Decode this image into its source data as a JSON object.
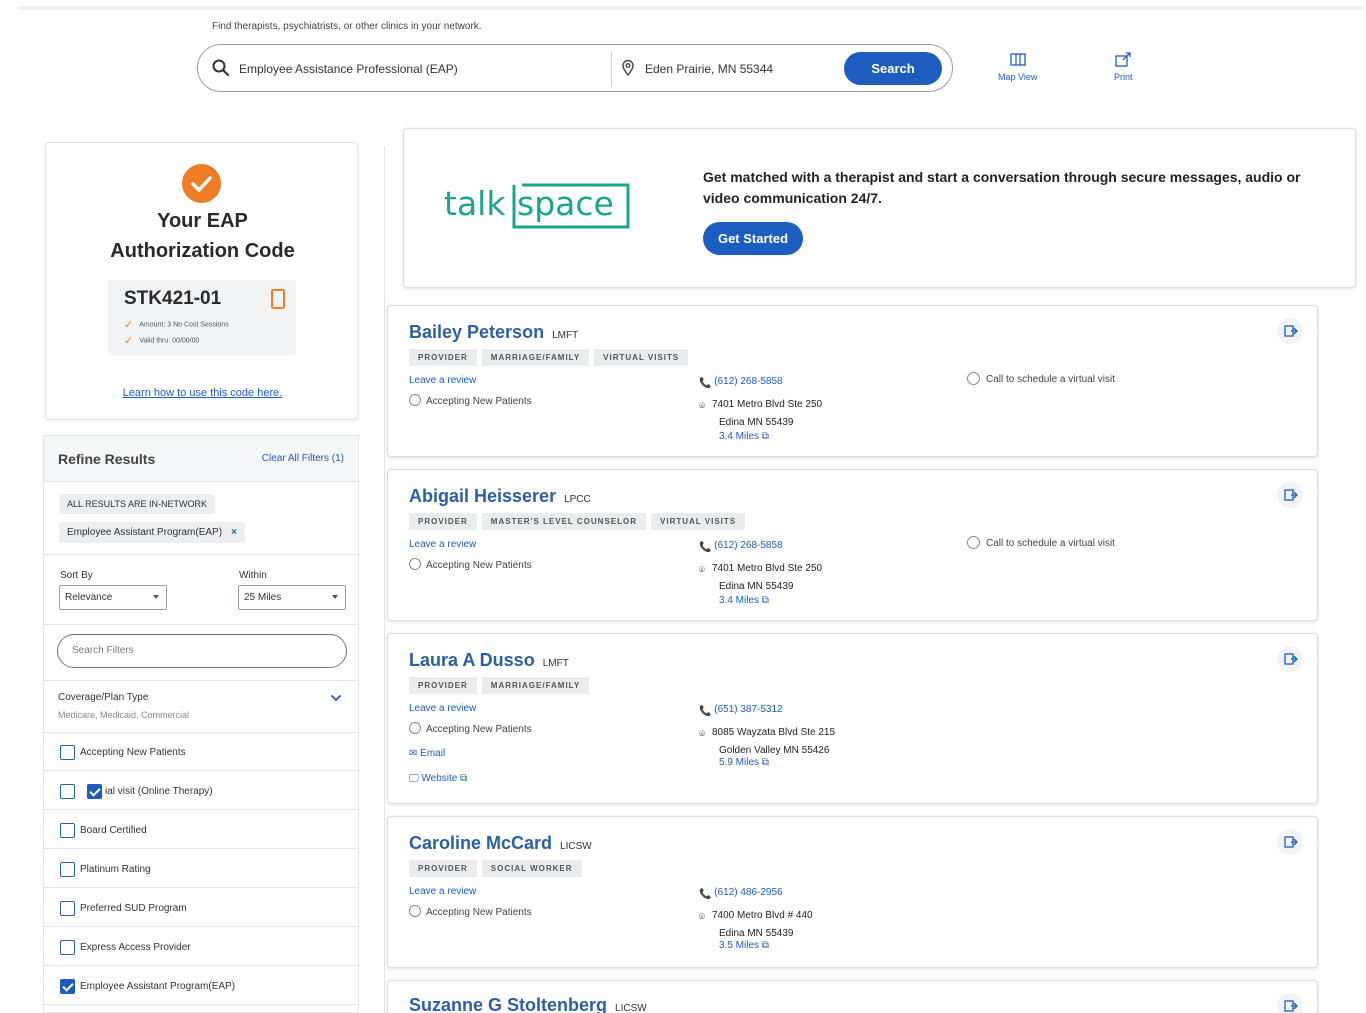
{
  "header": {
    "hint": "Find therapists, psychiatrists, or other clinics in your network.",
    "query": "Employee Assistance Professional (EAP)",
    "location": "Eden Prairie, MN 55344",
    "search_label": "Search",
    "map_label": "Map View",
    "print_label": "Print"
  },
  "eap": {
    "title_line1": "Your EAP",
    "title_line2": "Authorization Code",
    "code": "STK421-01",
    "detail1": "Amount: 3 No Cost Sessions",
    "detail2": "Valid thru: 00/00/00",
    "learn_link": "Learn how to use this code here."
  },
  "refine": {
    "title": "Refine Results",
    "clear_label": "Clear All Filters (1)",
    "network_pill": "ALL RESULTS ARE IN-NETWORK",
    "active_filter": "Employee Assistant Program(EAP)",
    "remove_filter": "×",
    "sort_label": "Sort By",
    "sort_value": "Relevance",
    "within_label": "Within",
    "within_value": "25 Miles",
    "filter_placeholder": "Search Filters",
    "coverage_title": "Coverage/Plan Type",
    "coverage_sub": "Medicare, Medicaid, Commercial",
    "checkboxes": [
      {
        "label": "Accepting New Patients",
        "checked": false
      },
      {
        "label": "ial visit (Online Therapy)",
        "checked": false
      },
      {
        "label": "Board Certified",
        "checked": false
      },
      {
        "label": "Platinum Rating",
        "checked": false
      },
      {
        "label": "Preferred SUD Program",
        "checked": false
      },
      {
        "label": "Express Access Provider",
        "checked": false
      },
      {
        "label": "Employee Assistant Program(EAP)",
        "checked": true
      }
    ]
  },
  "banner": {
    "logo_left": "talk",
    "logo_right": "space",
    "text": "Get matched with a therapist and start a conversation through secure messages, audio or video communication 24/7.",
    "button": "Get Started"
  },
  "common": {
    "review": "Leave a review",
    "accepting": "Accepting New Patients",
    "virtual": "Call to schedule a virtual visit",
    "email": "Email",
    "website": "Website"
  },
  "providers": [
    {
      "name": "Bailey Peterson",
      "cred": "LMFT",
      "tags": [
        "PROVIDER",
        "MARRIAGE/FAMILY",
        "VIRTUAL VISITS"
      ],
      "phone": "(612) 268-5858",
      "addr1": "7401 Metro Blvd Ste 250",
      "addr2": "Edina MN 55439",
      "miles": "3.4 Miles",
      "virtual": true
    },
    {
      "name": "Abigail Heisserer",
      "cred": "LPCC",
      "tags": [
        "PROVIDER",
        "MASTER'S LEVEL COUNSELOR",
        "VIRTUAL VISITS"
      ],
      "phone": "(612) 268-5858",
      "addr1": "7401 Metro Blvd Ste 250",
      "addr2": "Edina MN 55439",
      "miles": "3.4 Miles",
      "virtual": true
    },
    {
      "name": "Laura A Dusso",
      "cred": "LMFT",
      "tags": [
        "PROVIDER",
        "MARRIAGE/FAMILY"
      ],
      "phone": "(651) 387-5312",
      "addr1": "8085 Wayzata Blvd Ste 215",
      "addr2": "Golden Valley MN 55426",
      "miles": "5.9 Miles",
      "virtual": false
    },
    {
      "name": "Caroline McCard",
      "cred": "LICSW",
      "tags": [
        "PROVIDER",
        "SOCIAL WORKER"
      ],
      "phone": "(612) 486-2956",
      "addr1": "7400 Metro Blvd # 440",
      "addr2": "Edina MN 55439",
      "miles": "3.5 Miles",
      "virtual": false
    },
    {
      "name": "Suzanne G Stoltenberg",
      "cred": "LICSW"
    }
  ],
  "colors": {
    "accent": "#1d5dbf",
    "orange": "#ef7d25",
    "talkspace": "#1ba58b"
  }
}
